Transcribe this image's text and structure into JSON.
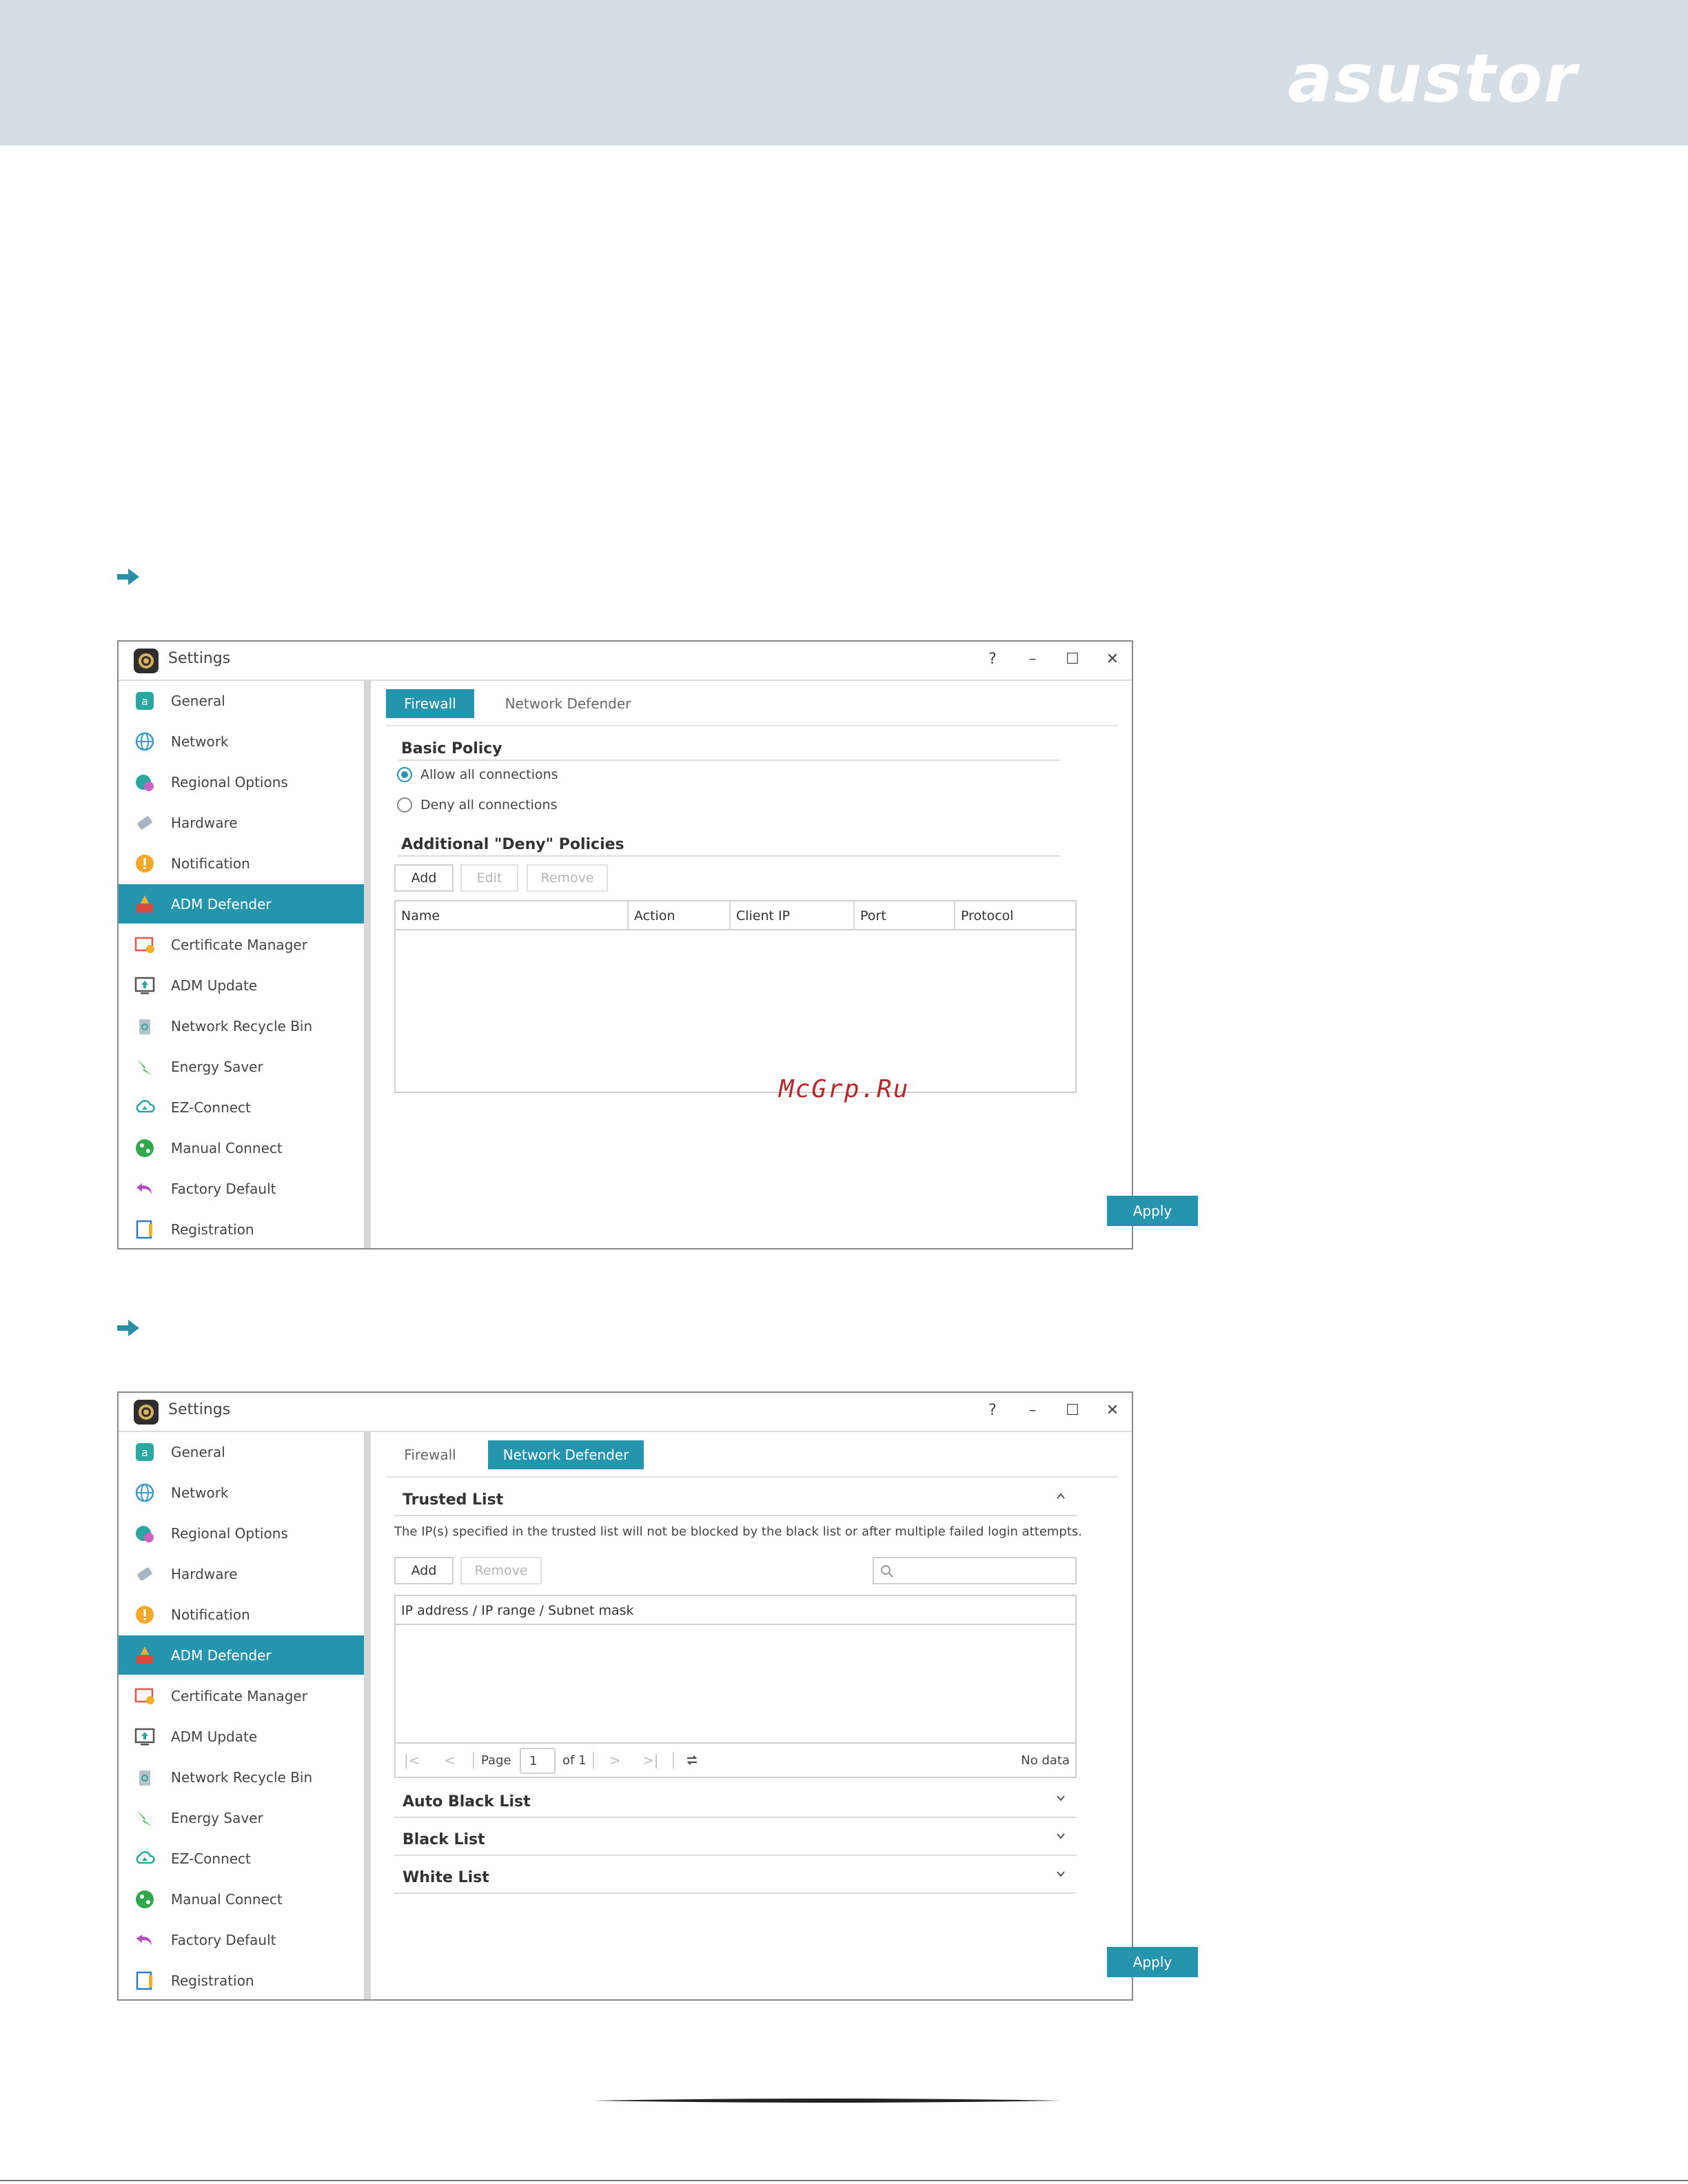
{
  "brand": {
    "logo_text": "asustor",
    "header_color": "#d5dee4"
  },
  "watermark": "McGrp.Ru",
  "accent_color": "#2594ad",
  "sidebar_items": [
    {
      "label": "General",
      "icon": "general-icon"
    },
    {
      "label": "Network",
      "icon": "globe-icon"
    },
    {
      "label": "Regional Options",
      "icon": "regional-icon"
    },
    {
      "label": "Hardware",
      "icon": "hardware-icon"
    },
    {
      "label": "Notification",
      "icon": "alert-icon"
    },
    {
      "label": "ADM Defender",
      "icon": "defender-icon"
    },
    {
      "label": "Certificate Manager",
      "icon": "certificate-icon"
    },
    {
      "label": "ADM Update",
      "icon": "update-icon"
    },
    {
      "label": "Network Recycle Bin",
      "icon": "recycle-bin-icon"
    },
    {
      "label": "Energy Saver",
      "icon": "energy-icon"
    },
    {
      "label": "EZ-Connect",
      "icon": "cloud-icon"
    },
    {
      "label": "Manual Connect",
      "icon": "connect-icon"
    },
    {
      "label": "Factory Default",
      "icon": "undo-icon"
    },
    {
      "label": "Registration",
      "icon": "registration-icon"
    }
  ],
  "window1": {
    "title": "Settings",
    "controls": {
      "help": "?",
      "minimize": "–",
      "maximize": "☐",
      "close": "✕"
    },
    "tabs": [
      {
        "label": "Firewall",
        "active": true
      },
      {
        "label": "Network Defender",
        "active": false
      }
    ],
    "basic_policy": {
      "title": "Basic Policy",
      "options": [
        {
          "label": "Allow all connections",
          "selected": true
        },
        {
          "label": "Deny all connections",
          "selected": false
        }
      ]
    },
    "deny_policies": {
      "title": "Additional \"Deny\" Policies",
      "buttons": {
        "add": "Add",
        "edit": "Edit",
        "remove": "Remove"
      },
      "columns": [
        "Name",
        "Action",
        "Client IP",
        "Port",
        "Protocol"
      ]
    },
    "apply": "Apply"
  },
  "window2": {
    "title": "Settings",
    "controls": {
      "help": "?",
      "minimize": "–",
      "maximize": "☐",
      "close": "✕"
    },
    "tabs": [
      {
        "label": "Firewall",
        "active": false
      },
      {
        "label": "Network Defender",
        "active": true
      }
    ],
    "trusted_list": {
      "title": "Trusted List",
      "description": "The IP(s) specified in the trusted list will not be blocked by the black list or after multiple failed login attempts.",
      "buttons": {
        "add": "Add",
        "remove": "Remove"
      },
      "column": "IP address / IP range / Subnet mask",
      "pager": {
        "page_label": "Page",
        "page_value": "1",
        "of_label": "of 1",
        "status": "No data"
      }
    },
    "sections": [
      "Auto Black List",
      "Black List",
      "White List"
    ],
    "apply": "Apply"
  }
}
